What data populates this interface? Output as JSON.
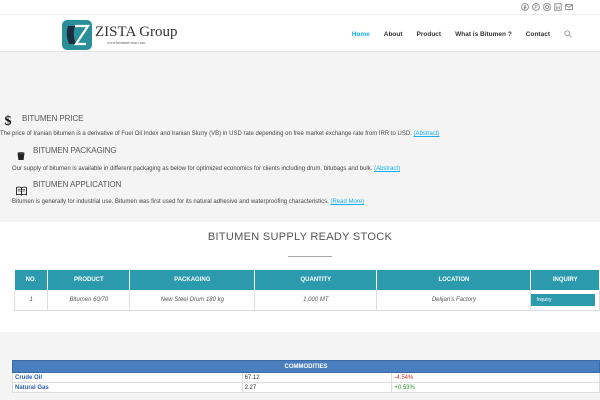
{
  "brand": {
    "name": "ZISTA Group",
    "sub": "www.bitumen-iran.com"
  },
  "social": [
    "facebook-icon",
    "pinterest-icon",
    "instagram-icon",
    "linkedin-icon",
    "mail-icon"
  ],
  "nav": {
    "items": [
      "Home",
      "About",
      "Product",
      "What is Bitumen ?",
      "Contact"
    ],
    "active": "Home"
  },
  "sections": {
    "price": {
      "title": "BITUMEN PRICE",
      "text": "The price of Iranian bitumen is a derivative of Fuel Oil Index and Iranian Slurry (VB) in USD rate depending on free market exchange rate from IRR to USD.",
      "link": "(Abstract)"
    },
    "packaging": {
      "title": "BITUMEN PACKAGING",
      "text": "Our supply of bitumen is available in different packaging as below for optimized economics for clients including drum, bitubags and bulk.",
      "link": "(Abstract)"
    },
    "application": {
      "title": "BITUMEN APPLICATION",
      "text": "Bitumen is generally for industrial use. Bitumen was first used for its natural adhesive and waterproofing characteristics.",
      "link": "(Read More)"
    }
  },
  "stock": {
    "title": "BITUMEN SUPPLY READY STOCK",
    "headers": [
      "NO.",
      "PRODUCT",
      "PACKAGING",
      "QUANTITY",
      "LOCATION",
      "INQUIRY"
    ],
    "rows": [
      {
        "no": "1",
        "product": "Bitumen 60/70",
        "packaging": "New Steel Drum 180 kg",
        "quantity": "1,000 MT",
        "location": "Delijan's Factory",
        "inquiry": "Inquiry"
      }
    ]
  },
  "commodities": {
    "title": "COMMODITIES",
    "rows": [
      {
        "name": "Crude Oil",
        "value": "67.12",
        "change": "-4.54%",
        "direction": "down"
      },
      {
        "name": "Natural Gas",
        "value": "2.27",
        "change": "+0.53%",
        "direction": "up"
      }
    ]
  },
  "colors": {
    "accent": "#13aff0",
    "table_header": "#2b9aad",
    "commodity_header": "#4a7fbf",
    "negative": "#d12f2f",
    "positive": "#2a9a2a"
  }
}
